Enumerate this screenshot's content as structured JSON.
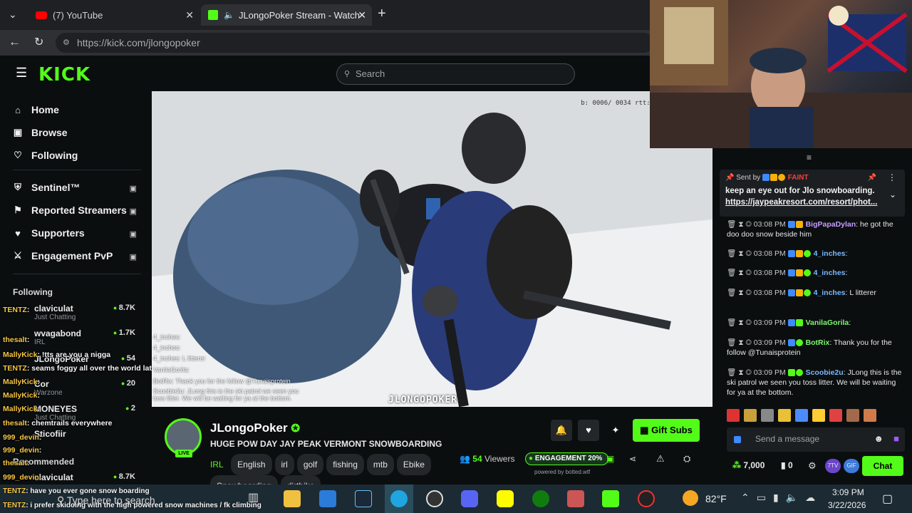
{
  "browser": {
    "tabs": [
      {
        "title": "(7) YouTube"
      },
      {
        "title": "JLongoPoker Stream - Watch"
      }
    ],
    "url": "https://kick.com/jlongopoker"
  },
  "kick": {
    "logo": "KICK",
    "search_placeholder": "Search"
  },
  "sidebar": {
    "nav": [
      {
        "label": "Home"
      },
      {
        "label": "Browse"
      },
      {
        "label": "Following"
      },
      {
        "label": "Sentinel™"
      },
      {
        "label": "Reported Streamers"
      },
      {
        "label": "Supporters"
      },
      {
        "label": "Engagement PvP"
      }
    ],
    "following_header": "Following",
    "recommended_header": "Recommended",
    "following": [
      {
        "name": "claviculat",
        "viewers": "8.7K",
        "category": "Just Chatting"
      },
      {
        "name": "wvagabond",
        "viewers": "1.7K",
        "category": "IRL"
      },
      {
        "name": "JLongoPoker",
        "viewers": "54",
        "category": ""
      },
      {
        "name": "Cor",
        "viewers": "20",
        "category": "Warzone"
      },
      {
        "name": "MONEYES",
        "viewers": "2",
        "category": "Just Chatting"
      },
      {
        "name": "Sticofiir",
        "viewers": "",
        "category": ""
      }
    ],
    "recommended": [
      {
        "name": "claviculat",
        "viewers": "8.7K"
      }
    ],
    "overlay_chat": [
      {
        "user": "TENTZ",
        "text": ":"
      },
      {
        "user": "thesalt",
        "text": ":"
      },
      {
        "user": "MallyKick",
        "text": ": !tts are you a nigga"
      },
      {
        "user": "TENTZ",
        "text": ": seams foggy all over the world lately"
      },
      {
        "user": "MallyKick",
        "text": ":"
      },
      {
        "user": "MallyKick",
        "text": ":"
      },
      {
        "user": "MallyKick",
        "text": ":"
      },
      {
        "user": "thesalt",
        "text": ": chemtrails everywhere"
      },
      {
        "user": "999_devin",
        "text": ":"
      },
      {
        "user": "999_devin",
        "text": ":"
      },
      {
        "user": "thesalt",
        "text": ":"
      },
      {
        "user": "999_devin",
        "text": ":"
      },
      {
        "user": "TENTZ",
        "text": ": have you ever gone snow boarding"
      },
      {
        "user": "TENTZ",
        "text": ": i prefer skidoing with the high powered snow machines / fk climbing"
      }
    ]
  },
  "video": {
    "stats": "b: 0006/ 0034 rtt: 50/ 52/ 60 bs:",
    "watermark": "JLONGOPOKER",
    "chat_overlay": [
      {
        "user": "4_inches",
        "text": ":"
      },
      {
        "user": "4_inches",
        "text": ":"
      },
      {
        "user": "4_inches",
        "text": ": L litterer"
      },
      {
        "user": "VanilaGorila",
        "text": ":"
      },
      {
        "user": "BotRix",
        "text": ": Thank you for the follow @Tunaisprotein"
      },
      {
        "user": "Scoobie2u",
        "text": ": JLong this is the ski patrol we seen you toss litter. We will be waiting for ya at the bottom."
      }
    ]
  },
  "stream": {
    "streamer": "JLongoPoker",
    "live_badge": "LIVE",
    "title": "HUGE POW DAY JAY PEAK VERMONT SNOWBOARDING",
    "category": "IRL",
    "tags": [
      "English",
      "irl",
      "golf",
      "fishing",
      "mtb",
      "Ebike",
      "Snowboarding",
      "dirtbike"
    ],
    "viewers": "54",
    "viewers_label": "Viewers",
    "engagement_label": "ENGAGEMENT 20%",
    "powered_by": "powered by botted.wtf",
    "gift_subs": "Gift Subs"
  },
  "chat": {
    "pinned": {
      "sent_by": "Sent by",
      "pinner": "FAINT",
      "text": "keep an eye out for Jlo snowboarding.",
      "link": "https://jaypeakresort.com/resort/phot..."
    },
    "messages": [
      {
        "time": "03:08 PM",
        "user": "BigPapaDylan",
        "text": ": he got the doo doo snow beside him",
        "color": "#c69cff"
      },
      {
        "time": "03:08 PM",
        "user": "4_inches",
        "text": ":",
        "color": "#7ab8ff"
      },
      {
        "time": "03:08 PM",
        "user": "4_inches",
        "text": ":",
        "color": "#7ab8ff"
      },
      {
        "time": "03:08 PM",
        "user": "4_inches",
        "text": ": L litterer",
        "color": "#7ab8ff"
      },
      {
        "time": "03:09 PM",
        "user": "VanilaGorila",
        "text": ":",
        "color": "#7cf76f"
      },
      {
        "time": "03:09 PM",
        "user": "BotRix",
        "text": ": Thank you for the follow @Tunaisprotein",
        "color": "#7cf76f"
      },
      {
        "time": "03:09 PM",
        "user": "Scoobie2u",
        "text": ": JLong this is the ski patrol we seen you toss litter. We will be waiting for ya at the bottom.",
        "color": "#7ab8ff"
      }
    ],
    "input_placeholder": "Send a message",
    "points": "7,000",
    "zero": "0",
    "chat_button": "Chat"
  },
  "taskbar": {
    "search_placeholder": "Type here to search",
    "weather": "82°F",
    "time": "3:09 PM",
    "date": "3/22/2026"
  },
  "colors": {
    "kick_green": "#53fc18",
    "bg": "#0b0e0f"
  }
}
